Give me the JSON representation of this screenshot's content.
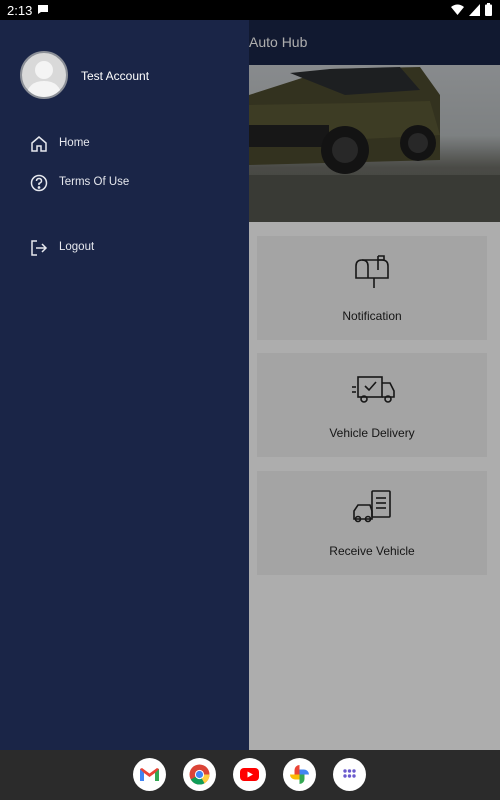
{
  "status_bar": {
    "time": "2:13",
    "icons": [
      "wifi-icon",
      "signal-icon",
      "battery-icon"
    ]
  },
  "app_bar": {
    "title": "Auto Hub"
  },
  "cards": [
    {
      "label": "Notification",
      "icon": "mailbox-icon"
    },
    {
      "label": "Vehicle Delivery",
      "icon": "delivery-truck-icon"
    },
    {
      "label": "Receive Vehicle",
      "icon": "car-checklist-icon"
    }
  ],
  "drawer": {
    "account_name": "Test Account",
    "items": [
      {
        "label": "Home",
        "icon": "home-icon"
      },
      {
        "label": "Terms Of Use",
        "icon": "help-icon"
      },
      {
        "label": "Logout",
        "icon": "logout-icon"
      }
    ]
  },
  "dock": {
    "apps": [
      "gmail-icon",
      "chrome-icon",
      "youtube-icon",
      "photos-icon",
      "app-drawer-icon"
    ]
  },
  "colors": {
    "drawer_bg": "#1a2547",
    "card_bg": "#f2f2f2",
    "navbar_bg": "#2b2b2b"
  }
}
